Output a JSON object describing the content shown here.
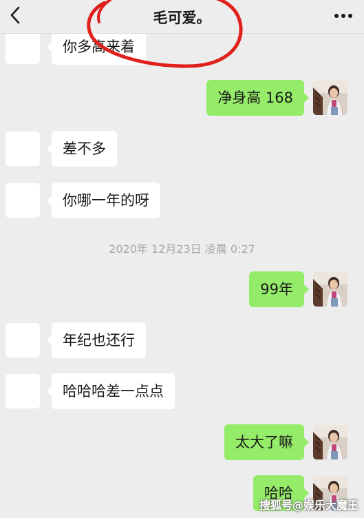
{
  "header": {
    "title": "毛可爱。",
    "back_icon": "chevron-left-icon",
    "more_icon": "more-dots-icon"
  },
  "colors": {
    "background": "#ededed",
    "incoming_bubble": "#ffffff",
    "outgoing_bubble": "#95ec69",
    "annotation_circle": "#e0201c"
  },
  "messages": [
    {
      "dir": "in",
      "text": "你多高来着"
    },
    {
      "dir": "out",
      "text": "净身高 168"
    },
    {
      "dir": "in",
      "text": "差不多"
    },
    {
      "dir": "in",
      "text": "你哪一年的呀"
    },
    {
      "dir": "out",
      "text": "99年"
    },
    {
      "dir": "in",
      "text": "年纪也还行"
    },
    {
      "dir": "in",
      "text": "哈哈哈差一点点"
    },
    {
      "dir": "out",
      "text": "太大了嘛"
    },
    {
      "dir": "out",
      "text": "哈哈"
    }
  ],
  "timestamp": "2020年 12月23日 凌晨 0:27",
  "watermark": "搜狐号@娱乐大魔王"
}
